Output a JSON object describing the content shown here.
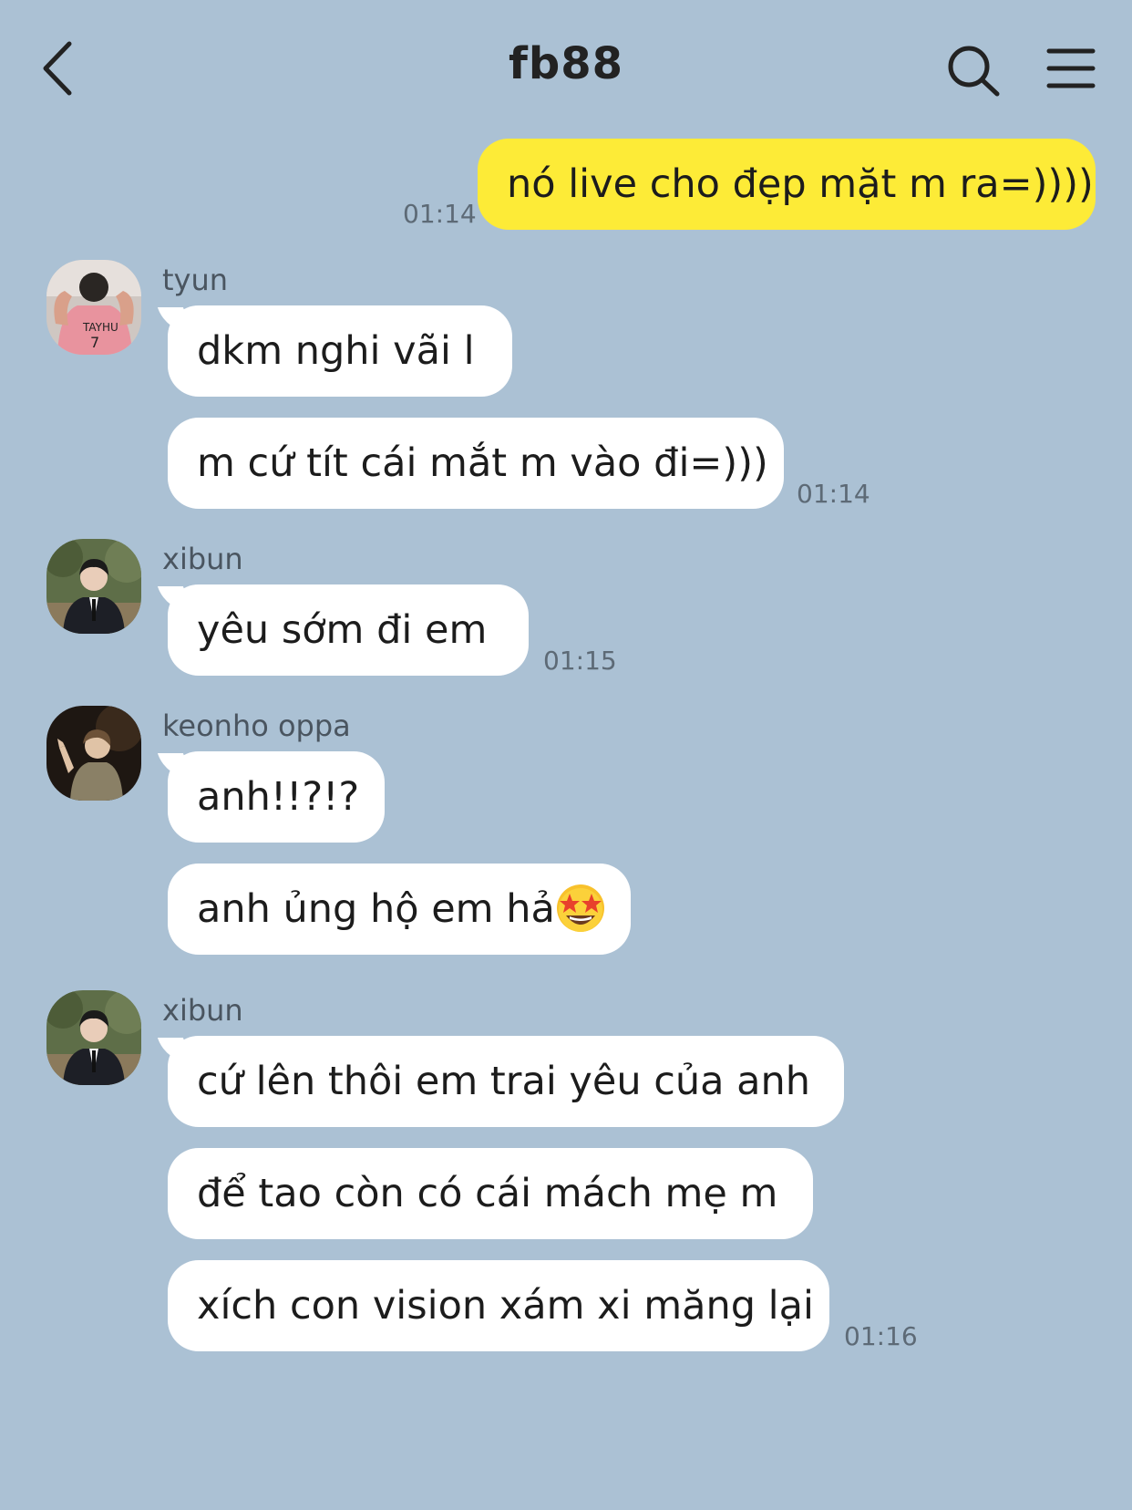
{
  "header": {
    "title": "fb88",
    "back_icon": "chevron-left-icon",
    "search_icon": "search-icon",
    "menu_icon": "hamburger-menu-icon"
  },
  "colors": {
    "background": "#abc1d4",
    "outgoing_bubble": "#fdeb37",
    "incoming_bubble": "#ffffff"
  },
  "messages": [
    {
      "direction": "outgoing",
      "text": "nó live cho đẹp mặt m ra=))))",
      "time": "01:14"
    },
    {
      "direction": "incoming",
      "sender": "tyun",
      "avatar": "avatar-tyun",
      "text": "dkm nghi vãi l"
    },
    {
      "direction": "incoming",
      "sender": "tyun",
      "text": "m cứ tít cái mắt m vào đi=)))",
      "time": "01:14"
    },
    {
      "direction": "incoming",
      "sender": "xibun",
      "avatar": "avatar-xibun",
      "text": "yêu sớm đi em",
      "time": "01:15"
    },
    {
      "direction": "incoming",
      "sender": "keonho oppa",
      "avatar": "avatar-keonho",
      "text": "anh!!?!?"
    },
    {
      "direction": "incoming",
      "sender": "keonho oppa",
      "text": "anh ủng hộ em hả",
      "emoji": "star-struck-emoji"
    },
    {
      "direction": "incoming",
      "sender": "xibun",
      "avatar": "avatar-xibun",
      "text": "cứ lên thôi em trai yêu của anh"
    },
    {
      "direction": "incoming",
      "sender": "xibun",
      "text": "để tao còn có cái mách mẹ m"
    },
    {
      "direction": "incoming",
      "sender": "xibun",
      "text": "xích con vision xám xi măng lại",
      "time": "01:16"
    }
  ]
}
